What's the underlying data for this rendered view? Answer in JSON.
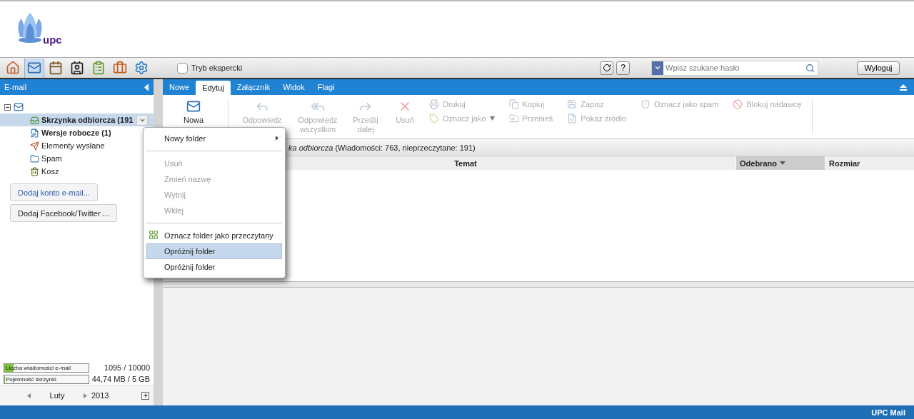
{
  "logo": {
    "text": "upc"
  },
  "toolbar": {
    "apps": [
      {
        "kind": "home",
        "selected": false
      },
      {
        "kind": "mail",
        "selected": true
      },
      {
        "kind": "calendar",
        "selected": false
      },
      {
        "kind": "contacts",
        "selected": false
      },
      {
        "kind": "tasks",
        "selected": false
      },
      {
        "kind": "briefcase",
        "selected": false
      },
      {
        "kind": "settings",
        "selected": false
      }
    ],
    "expert_mode": {
      "label": "Tryb ekspercki",
      "checked": false
    },
    "help": "?",
    "search": {
      "placeholder": "Wpisz szukane hasło"
    },
    "logout": "Wyloguj"
  },
  "sidebar": {
    "title": "E-mail",
    "account": {
      "expanded": true
    },
    "folders": [
      {
        "kind": "inbox",
        "label": "Skrzynka odbiorcza (191",
        "unread": true,
        "selected": true
      },
      {
        "kind": "drafts",
        "label": "Wersje robocze (1)",
        "unread": true,
        "selected": false
      },
      {
        "kind": "sent",
        "label": "Elementy wysłane",
        "unread": false,
        "selected": false
      },
      {
        "kind": "spam",
        "label": "Spam",
        "unread": false,
        "selected": false
      },
      {
        "kind": "trash",
        "label": "Kosz",
        "unread": false,
        "selected": false
      }
    ],
    "buttons": [
      {
        "kind": "link",
        "label": "Dodaj konto e-mail..."
      },
      {
        "kind": "plain",
        "label": "Dodaj Facebook/Twitter ..."
      }
    ],
    "meters": [
      {
        "label": "Liczba wiadomości e-mail",
        "level": 0.11,
        "reading": "1095 / 10000"
      },
      {
        "label": "Pojemność skrzynki",
        "level": 0.01,
        "reading": "44,74 MB / 5 GB"
      }
    ],
    "calendar": {
      "month": "Luty",
      "year": "2013"
    }
  },
  "tabs": [
    {
      "label": "Nowe",
      "selected": false
    },
    {
      "label": "Edytuj",
      "selected": true
    },
    {
      "label": "Załącznik",
      "selected": false
    },
    {
      "label": "Widok",
      "selected": false
    },
    {
      "label": "Flagi",
      "selected": false
    }
  ],
  "ribbon": {
    "large": [
      {
        "kind": "new",
        "label": "Nowa",
        "disabled": false
      },
      {
        "kind": "reply",
        "label": "Odpowiedz",
        "disabled": true
      },
      {
        "kind": "reply-all",
        "label": "Odpowiedz wszystkim",
        "disabled": true
      },
      {
        "kind": "forward",
        "label": "Prześlij dalej",
        "disabled": true
      },
      {
        "kind": "delete",
        "label": "Usuń",
        "disabled": true
      }
    ],
    "small": [
      [
        {
          "kind": "print",
          "label": "Drukuj",
          "disabled": true
        },
        {
          "kind": "mark",
          "label": "Oznacz jako",
          "disabled": true,
          "dropdown": true
        }
      ],
      [
        {
          "kind": "copy",
          "label": "Kopiuj",
          "disabled": true
        },
        {
          "kind": "move",
          "label": "Przenieś",
          "disabled": true
        }
      ],
      [
        {
          "kind": "save",
          "label": "Zapisz",
          "disabled": true
        },
        {
          "kind": "source",
          "label": "Pokaż źródło",
          "disabled": true
        }
      ],
      [
        {
          "kind": "spam",
          "label": "Oznacz jako spam",
          "disabled": true
        }
      ],
      [
        {
          "kind": "block",
          "label": "Blokuj nadawcę",
          "disabled": true
        }
      ]
    ]
  },
  "folder_info": "*ka odbiorcza* (Wiadomości: 763, nieprzeczytane: 191)",
  "table": {
    "columns": [
      {
        "label": "Temat",
        "sorted": false
      },
      {
        "label": "Odebrano",
        "sorted": true
      },
      {
        "label": "Rozmiar",
        "sorted": false
      }
    ]
  },
  "context_menu": {
    "items": [
      {
        "kind": "submenu",
        "label": "Nowy folder",
        "disabled": false,
        "selected": false
      },
      {
        "kind": "separator"
      },
      {
        "kind": "item",
        "label": "Usuń",
        "disabled": true,
        "selected": false
      },
      {
        "kind": "item",
        "label": "Zmień nazwę",
        "disabled": true,
        "selected": false
      },
      {
        "kind": "item",
        "label": "Wytnij",
        "disabled": true,
        "selected": false
      },
      {
        "kind": "item",
        "label": "Wklej",
        "disabled": true,
        "selected": false
      },
      {
        "kind": "separator"
      },
      {
        "kind": "icon-item",
        "label": "Oznacz folder jako przeczytany",
        "disabled": false,
        "selected": false
      },
      {
        "kind": "item",
        "label": "Opróżnij folder",
        "disabled": false,
        "selected": true
      },
      {
        "kind": "item",
        "label": "Opróżnij folder",
        "disabled": false,
        "selected": false
      }
    ]
  },
  "status_bar": {
    "text": "UPC Mail"
  }
}
